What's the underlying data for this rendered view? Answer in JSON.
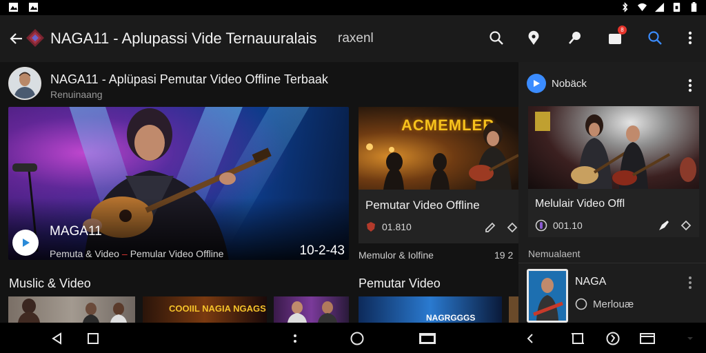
{
  "app": {
    "title": "NAGA11 - Aplupassi Vide Ternauuralais",
    "subtitle": "raxenl"
  },
  "toolbar": {
    "actions": [
      {
        "name": "search-icon"
      },
      {
        "name": "location-pin-icon"
      },
      {
        "name": "pin-icon"
      },
      {
        "name": "notifications-icon",
        "badge": "8"
      },
      {
        "name": "search-icon-blue"
      },
      {
        "name": "more-vert-icon"
      }
    ]
  },
  "channel": {
    "title": "NAGA11 - Aplüpasi Pemutar Video Offline Terbaak",
    "subtitle": "Renuinaang"
  },
  "featured": {
    "title": "MAGA11",
    "subtitle_left": "Pemuta & Video",
    "subtitle_right": "Pemular Video Offline",
    "date": "10-2-43"
  },
  "card1": {
    "marquee": "ACMEMLER",
    "title": "Pemutar Video Offline",
    "meta": "01.810",
    "caption_left": "Memulor & Iolfine",
    "caption_right": "19 2"
  },
  "sections": {
    "music_video": "Muslic & Video",
    "pemutar_video": "Pemutar Video"
  },
  "strip": {
    "poster_text": "COOIIL NAGIA NGAGS",
    "poster2_text": "NAGRGGGS"
  },
  "side": {
    "name": "Nobäck",
    "card_title": "Melulair Video Offl",
    "card_meta": "001.10",
    "section_label": "Nemualaent",
    "item_title": "NAGA",
    "item_sub": "Merlouæ"
  },
  "colors": {
    "accent_blue": "#3b8cff",
    "badge_red": "#e5342b",
    "background": "#121212"
  }
}
